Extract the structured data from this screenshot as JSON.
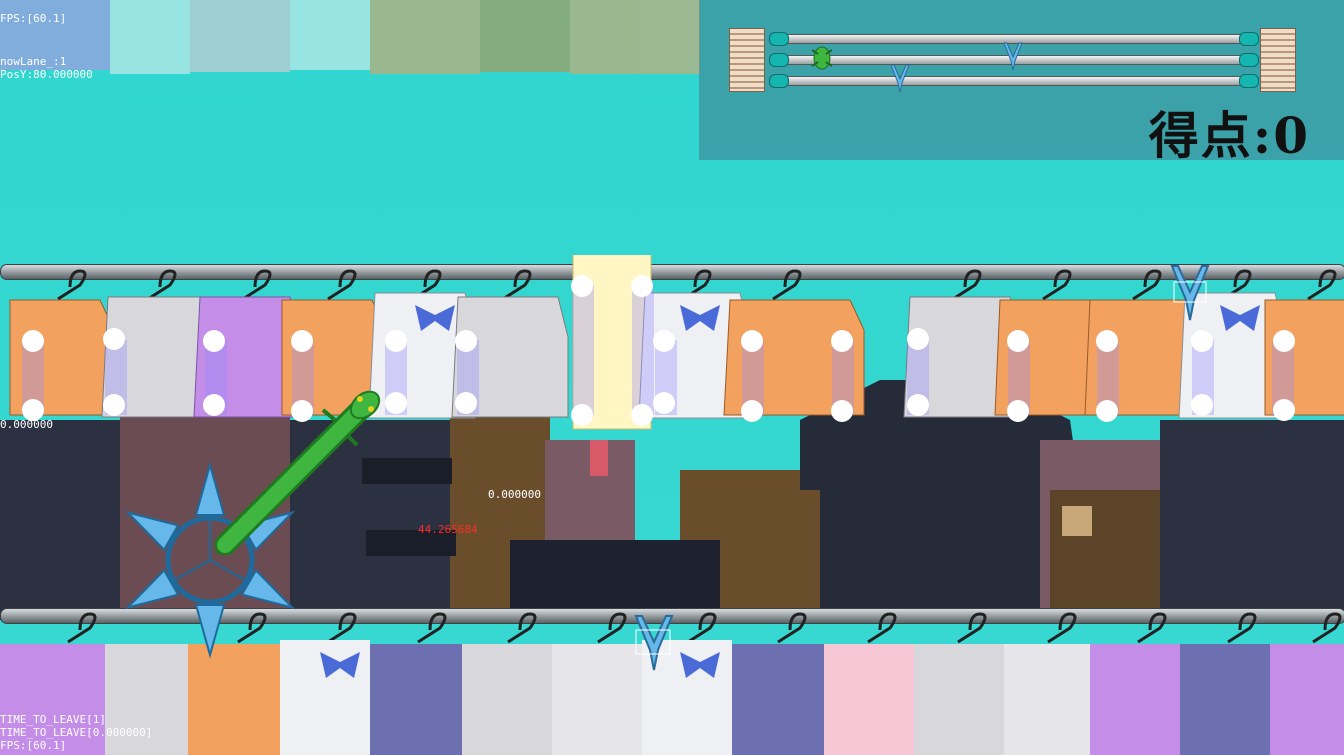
{
  "debug": {
    "fps_top": "FPS:[60.1]",
    "now_lane": "nowLane_:1",
    "pos_y": "PosY:80.000000",
    "value_left": "0.000000",
    "value_mid": "0.000000",
    "angle_red": "44.265684",
    "time_to_leave_count": "TIME_TO_LEAVE[1]",
    "time_to_leave_value": "TIME_TO_LEAVE[0.000000]",
    "fps_bottom": "FPS:[60.1]"
  },
  "hud": {
    "score_label": "得点:0"
  },
  "colors": {
    "sky": "#35d6d0",
    "shirt_orange": "#f2a15e",
    "shirt_purple": "#c38de8",
    "shirt_white": "#eef0f4",
    "shirt_grey": "#d8d8dc",
    "shirt_navy": "#6c6fb0",
    "shirt_pink": "#f6c8d6",
    "clip_blue": "#66b8ea",
    "lizard_green": "#3fb63f"
  },
  "icons": {
    "player": "lizard-icon",
    "enemy": "clothespin-icon",
    "hazard": "spinning-clothespin-wheel-icon",
    "hanger": "hanger-icon"
  }
}
